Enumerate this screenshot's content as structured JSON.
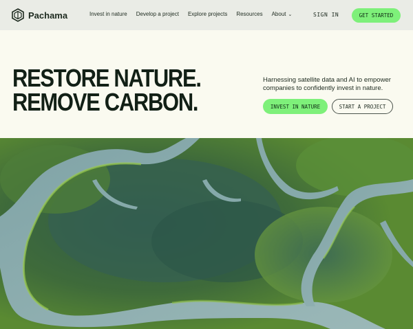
{
  "brand": {
    "name": "Pachama",
    "logo_icon": "hexagon-tree-logo"
  },
  "nav": {
    "links": [
      "Invest in nature",
      "Develop a project",
      "Explore projects",
      "Resources",
      "About"
    ],
    "signin_label": "SIGN IN",
    "cta_label": "GET STARTED"
  },
  "hero": {
    "headline_line1": "RESTORE NATURE.",
    "headline_line2": "REMOVE CARBON.",
    "subtext": "Harnessing satellite data and AI to empower companies to confidently invest in nature.",
    "primary_button": "INVEST IN NATURE",
    "secondary_button": "START A PROJECT"
  },
  "colors": {
    "accent_green": "#7ef07a",
    "text_dark": "#122016",
    "nav_bg": "#eaece6",
    "hero_bg": "#fafaf0"
  }
}
